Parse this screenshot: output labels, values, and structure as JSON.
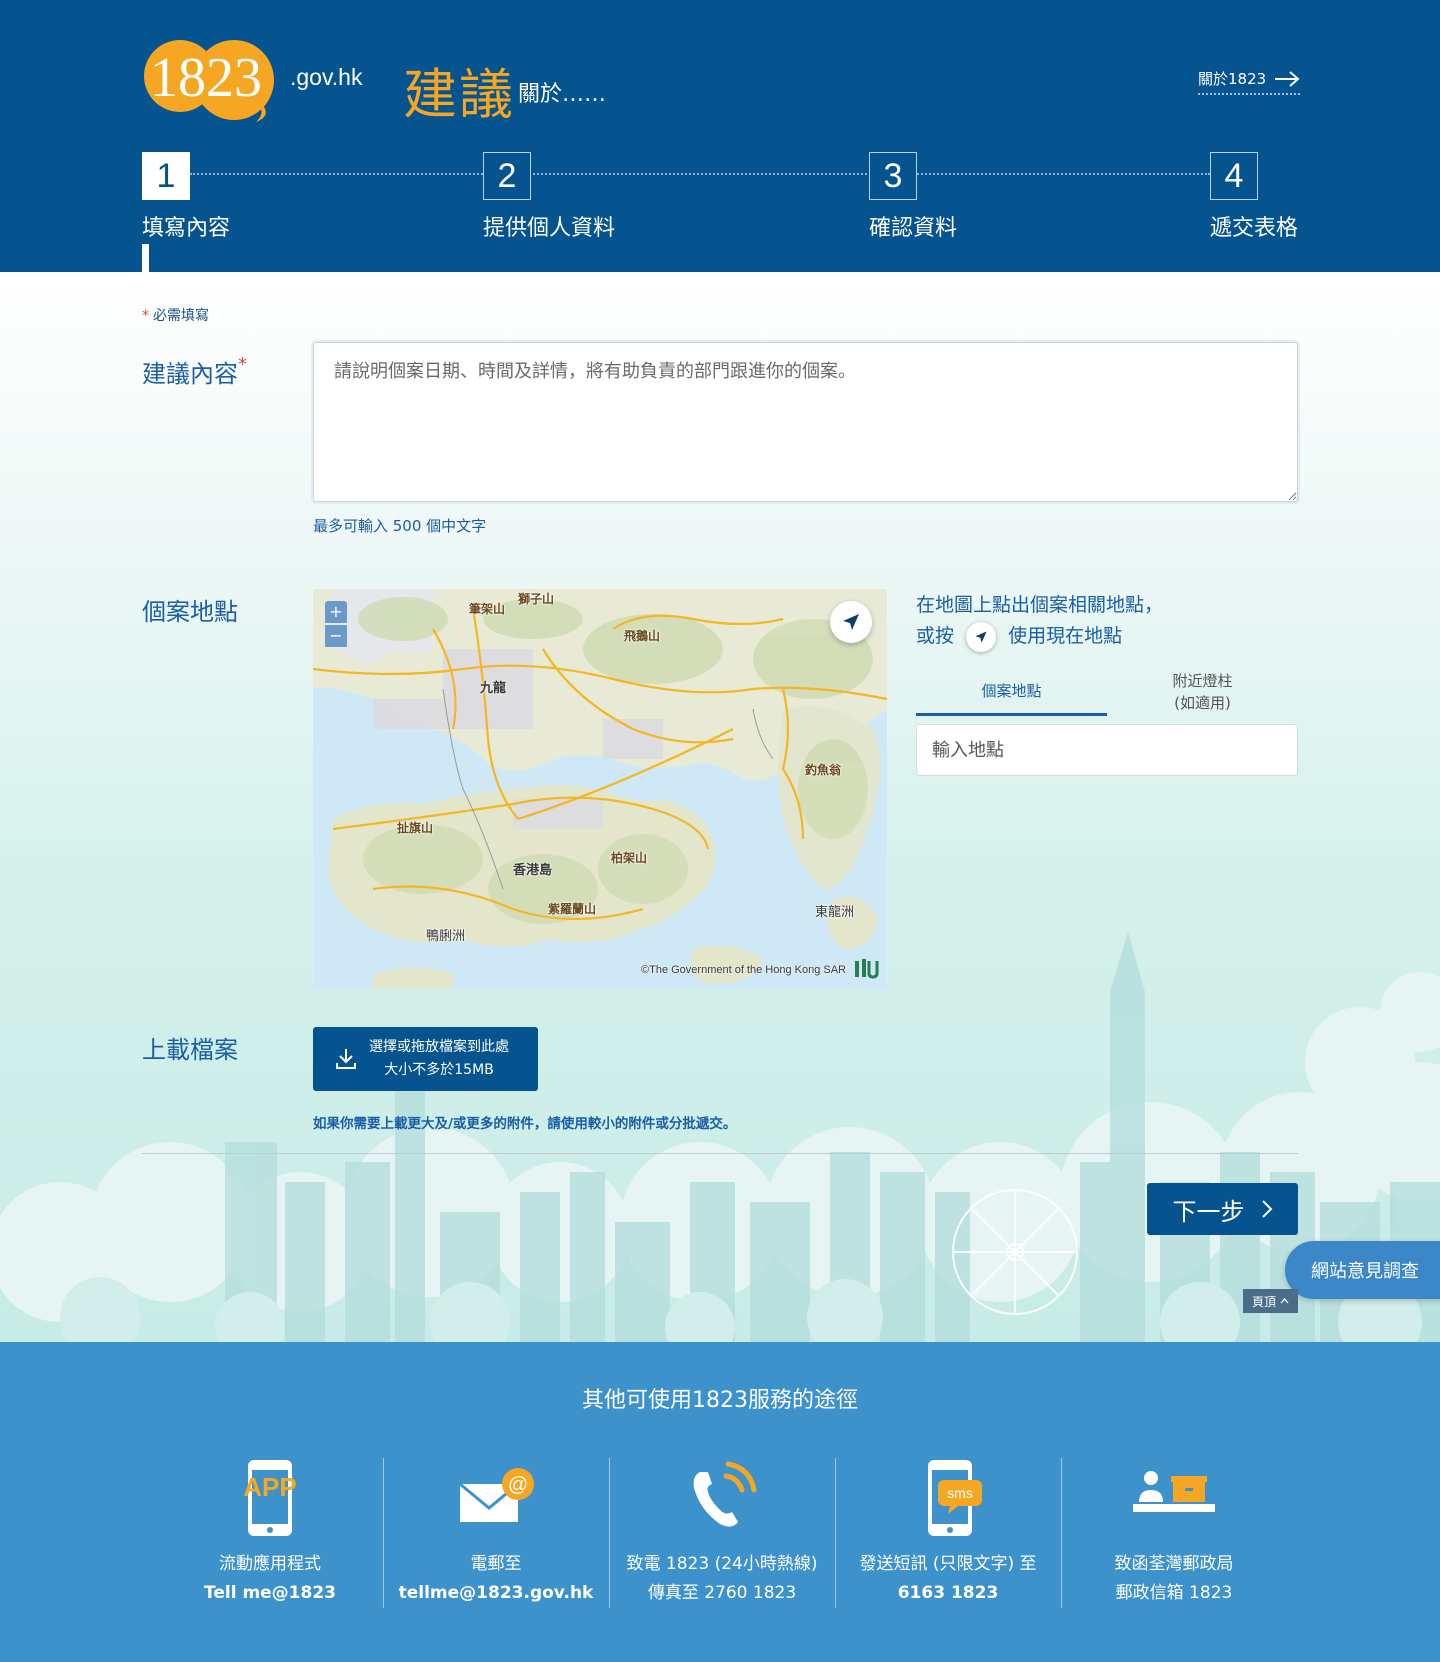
{
  "header": {
    "logo_text": "1823",
    "logo_domain": ".gov.hk",
    "title": "建議",
    "title_sub": "關於……",
    "about_link": "關於1823",
    "steps": [
      {
        "num": "1",
        "label": "填寫內容"
      },
      {
        "num": "2",
        "label": "提供個人資料"
      },
      {
        "num": "3",
        "label": "確認資料"
      },
      {
        "num": "4",
        "label": "遞交表格"
      }
    ],
    "active_step": 1
  },
  "form": {
    "required_note": "必需填寫",
    "content_label": "建議內容",
    "content_placeholder": "請說明個案日期、時間及詳情，將有助負責的部門跟進你的個案。",
    "content_hint": "最多可輸入 500 個中文字",
    "location_label": "個案地點",
    "map": {
      "zoom_in": "+",
      "zoom_out": "−",
      "places": [
        "筆架山",
        "獅子山",
        "飛鵝山",
        "九龍",
        "釣魚翁",
        "扯旗山",
        "香港島",
        "柏架山",
        "紫羅蘭山",
        "鴨脷洲",
        "東龍洲"
      ],
      "copyright": "©The Government of the Hong Kong SAR"
    },
    "map_instruction_line1": "在地圖上點出個案相關地點，",
    "map_instruction_pre": "或按",
    "map_instruction_post": "使用現在地點",
    "location_tabs": [
      {
        "label": "個案地點",
        "active": true
      },
      {
        "label_line1": "附近燈柱",
        "label_line2": "(如適用)",
        "active": false
      }
    ],
    "location_placeholder": "輸入地點",
    "upload_label": "上載檔案",
    "upload_line1": "選擇或拖放檔案到此處",
    "upload_line2": "大小不多於15MB",
    "upload_note": "如果你需要上載更大及/或更多的附件，請使用較小的附件或分批遞交。",
    "next_button": "下一步",
    "survey_button": "網站意見調查",
    "top_button": "頁頂"
  },
  "footer": {
    "title": "其他可使用1823服務的途徑",
    "channels": [
      {
        "icon": "app-phone-icon",
        "icon_text": "APP",
        "line1": "流動應用程式",
        "line2": "Tell me@1823"
      },
      {
        "icon": "email-icon",
        "icon_text": "@",
        "line1": "電郵至",
        "line2": "tellme@1823.gov.hk"
      },
      {
        "icon": "phone-call-icon",
        "line1": "致電 1823 (24小時熱線)",
        "line2": "傳真至 2760 1823"
      },
      {
        "icon": "sms-phone-icon",
        "icon_text": "sms",
        "line1": "發送短訊 (只限文字) 至",
        "line2": "6163 1823"
      },
      {
        "icon": "post-office-icon",
        "line1": "致函荃灣郵政局",
        "line2": "郵政信箱 1823"
      }
    ]
  },
  "colors": {
    "header_bg": "#06548f",
    "accent_orange": "#f5a623",
    "footer_bg": "#3e92cc",
    "required_red": "#e0443e",
    "link_blue": "#1a5fa6"
  }
}
